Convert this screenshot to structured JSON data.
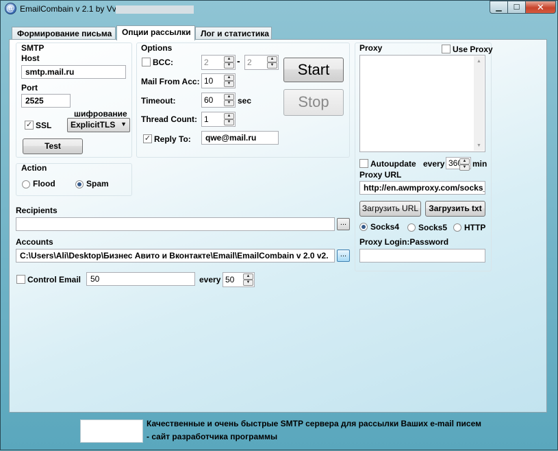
{
  "window": {
    "title": "EmailCombain v 2.1 by Vvksot",
    "icon_glyph": "@",
    "minimize_glyph": "▁",
    "maximize_glyph": "☐",
    "close_glyph": "✕"
  },
  "tabs": [
    {
      "label": "Формирование письма"
    },
    {
      "label": "Опции рассылки"
    },
    {
      "label": "Лог и статистика"
    }
  ],
  "smtp": {
    "group_label": "SMTP",
    "host_label": "Host",
    "host_value": "smtp.mail.ru",
    "port_label": "Port",
    "port_value": "2525",
    "encryption_label": "шифрование",
    "ssl_label": "SSL",
    "ssl_checked": true,
    "encryption_value": "ExplicitTLS",
    "test_button": "Test"
  },
  "options": {
    "group_label": "Options",
    "bcc_label": "BCC:",
    "bcc_checked": false,
    "bcc_from": "2",
    "bcc_dash": "-",
    "bcc_to": "2",
    "mail_from_acc_label": "Mail From Acc:",
    "mail_from_acc_value": "10",
    "timeout_label": "Timeout:",
    "timeout_value": "60",
    "timeout_unit": "sec",
    "thread_count_label": "Thread Count:",
    "thread_count_value": "1",
    "reply_to_label": "Reply To:",
    "reply_to_checked": true,
    "reply_to_value": "qwe@mail.ru"
  },
  "controls": {
    "start_button": "Start",
    "stop_button": "Stop"
  },
  "action": {
    "group_label": "Action",
    "options": [
      {
        "label": "Flood",
        "selected": false
      },
      {
        "label": "Spam",
        "selected": true
      }
    ]
  },
  "recipients": {
    "label": "Recipients",
    "value": "",
    "browse_glyph": "..."
  },
  "accounts": {
    "label": "Accounts",
    "value": "C:\\Users\\Ali\\Desktop\\Бизнес Авито и Вконтакте\\Email\\EmailCombain v 2.0 v2.",
    "browse_glyph": "..."
  },
  "control_email": {
    "label": "Control Email",
    "checked": false,
    "value": "50",
    "every_label": "every",
    "every_value": "50"
  },
  "proxy": {
    "group_label": "Proxy",
    "use_proxy_label": "Use Proxy",
    "use_proxy_checked": false,
    "autoupdate_label": "Autoupdate",
    "autoupdate_checked": false,
    "every_label": "every",
    "every_value": "360",
    "min_label": "min",
    "url_label": "Proxy URL",
    "url_value": "http://en.awmproxy.com/socks_",
    "load_url_button": "Загрузить URL",
    "load_txt_button": "Загрузить txt",
    "types": [
      {
        "label": "Socks4",
        "selected": true
      },
      {
        "label": "Socks5",
        "selected": false
      },
      {
        "label": "HTTP",
        "selected": false
      }
    ],
    "login_label": "Proxy Login:Password",
    "login_value": ""
  },
  "footer": {
    "line1": "Качественные и очень быстрые SMTP сервера для рассылки Ваших e-mail писем",
    "line2": "- сайт разработчика программы"
  },
  "colors": {
    "window_frame": "#5aa7bd",
    "close_button": "#c7452c",
    "radio_dot": "#355a8a"
  }
}
